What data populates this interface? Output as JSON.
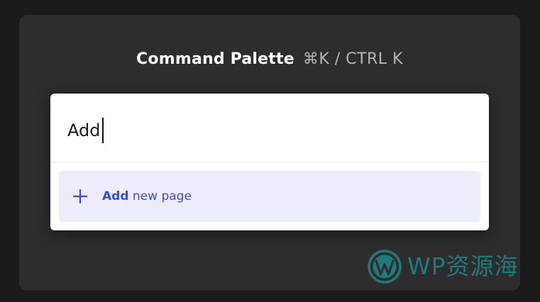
{
  "header": {
    "title": "Command Palette",
    "shortcut": "⌘K / CTRL K"
  },
  "palette": {
    "input_value": "Add",
    "results": [
      {
        "icon": "plus-icon",
        "match": "Add",
        "rest": " new page"
      }
    ]
  },
  "watermark": {
    "text": "WP资源海",
    "logo": "wordpress-logo"
  },
  "colors": {
    "page_background": "#1b1b1b",
    "card_background": "#2d2d2d",
    "result_highlight": "#ececfb",
    "accent": "#3b4fcf",
    "watermark": "#1e8a8e"
  }
}
